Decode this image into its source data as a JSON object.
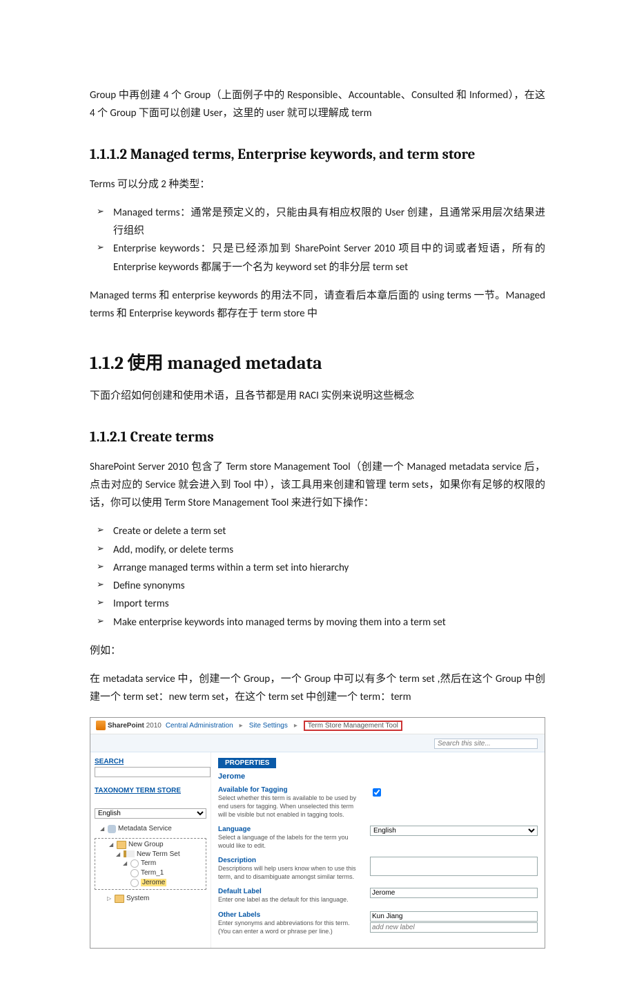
{
  "intro_para": "Group 中再创建 4 个 Group（上面例子中的 Responsible、Accountable、Consulted 和 Informed），在这 4 个 Group 下面可以创建 User，这里的 user 就可以理解成 term",
  "h_1112": "1.1.1.2    Managed terms, Enterprise keywords, and term store",
  "p_terms_intro": "Terms 可以分成 2 种类型：",
  "bl1": [
    "Managed terms：通常是预定义的，只能由具有相应权限的 User 创建，且通常采用层次结果进行组织",
    "Enterprise keywords：只是已经添加到 SharePoint Server 2010 项目中的词或者短语，所有的 Enterprise keywords 都属于一个名为 keyword set 的非分层 term set"
  ],
  "p_after1": "Managed terms 和 enterprise keywords 的用法不同，请查看后本章后面的 using terms 一节。Managed terms 和 Enterprise keywords 都存在于 term store 中",
  "h_112": "1.1.2  使用 managed metadata",
  "p_112_intro": "下面介绍如何创建和使用术语，且各节都是用 RACI 实例来说明这些概念",
  "h_1121": "1.1.2.1    Create terms",
  "p_1121_a": "SharePoint Server 2010 包含了 Term store Management Tool（创建一个 Managed metadata service 后，点击对应的 Service 就会进入到 Tool 中），该工具用来创建和管理 term sets，如果你有足够的权限的话，你可以使用 Term Store Management Tool 来进行如下操作：",
  "bl2": [
    "Create or delete a term set",
    "Add, modify, or delete terms",
    "Arrange managed terms within a term set into hierarchy",
    "Define synonyms",
    "Import terms",
    "Make enterprise keywords into managed terms by moving them into a term set"
  ],
  "p_eg": "例如：",
  "p_eg2": "在 metadata service 中，创建一个 Group，一个 Group 中可以有多个 term set ,然后在这个 Group 中创建一个 term set：new term set，在这个 term set 中创建一个 term：term",
  "shot": {
    "logo_text": "SharePoint 2010",
    "crumbs": [
      "Central Administration",
      "Site Settings"
    ],
    "crumb_last": "Term Store Management Tool",
    "search_ph": "Search this site...",
    "left_search_title": "SEARCH",
    "left_store_title": "TAXONOMY TERM STORE",
    "lang": "English",
    "tree": {
      "root": "Metadata Service",
      "group": "New Group",
      "set": "New Term Set",
      "t1": "Term",
      "t2": "Term_1",
      "t3": "Jerome",
      "sys": "System"
    },
    "props_tab": "PROPERTIES",
    "term_name": "Jerome",
    "rows": {
      "tag_t": "Available for Tagging",
      "tag_h": "Select whether this term is available to be used by end users for tagging. When unselected this term will be visible but not enabled in tagging tools.",
      "lang_t": "Language",
      "lang_h": "Select a language of the labels for the term you would like to edit.",
      "lang_v": "English",
      "desc_t": "Description",
      "desc_h": "Descriptions will help users know when to use this term, and to disambiguate amongst similar terms.",
      "def_t": "Default Label",
      "def_h": "Enter one label as the default for this language.",
      "def_v": "Jerome",
      "oth_t": "Other Labels",
      "oth_h": "Enter synonyms and abbreviations for this term. (You can enter a word or phrase per line.)",
      "oth_v1": "Kun Jiang",
      "oth_ph": "add new label"
    }
  }
}
